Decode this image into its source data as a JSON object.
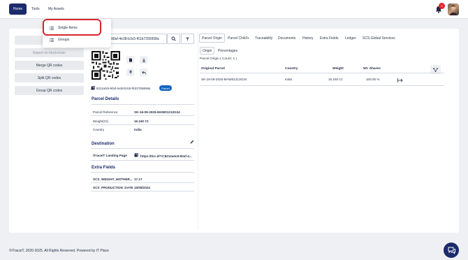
{
  "nav": {
    "home_label": "Home",
    "tools_label": "Tools",
    "my_assets_label": "My Assets",
    "notification_count": "0"
  },
  "dropdown": {
    "items": [
      {
        "label": "Single-Items"
      },
      {
        "label": "Groups"
      }
    ]
  },
  "left_panel": {
    "buttons": [
      {
        "label": "Create"
      },
      {
        "label": "Export on blockchain"
      },
      {
        "label": "Merge QR codes"
      },
      {
        "label": "Split QR codes"
      },
      {
        "label": "Group QR codes"
      }
    ]
  },
  "search": {
    "value": "90af-4e38-b3c5-f61b7255958a"
  },
  "item": {
    "uid": "8212a0c8-90af-4e38-b3c5-f61b7255958a",
    "type_badge": "Parcel"
  },
  "parcel_details": {
    "title": "Parcel Details",
    "rows": [
      {
        "label": "Parcel Reference",
        "value": "SK-16-09-2025-MAW01213G34"
      },
      {
        "label": "Weight(Ct)",
        "value": "16.160 Ct."
      },
      {
        "label": "Country",
        "value": "India"
      }
    ]
  },
  "destination": {
    "title": "Destination",
    "label": "iTraceiT Landing Page",
    "url": "https://tirc.it/?i=8212a0c8-90af-4..."
  },
  "extra_fields": {
    "title": "Extra Fields",
    "rows": [
      {
        "label": "SCS_WEIGHT_MOTHER...",
        "value": "17.17"
      },
      {
        "label": "SCS_PRODUCTION_DATE",
        "value": "15/08/2024"
      }
    ]
  },
  "tabs": [
    {
      "label": "Parcel Origin",
      "active": true
    },
    {
      "label": "Parcel Child's",
      "active": false
    },
    {
      "label": "Traceability",
      "active": false
    },
    {
      "label": "Documents",
      "active": false
    },
    {
      "label": "History",
      "active": false
    },
    {
      "label": "Extra Fields",
      "active": false
    },
    {
      "label": "Ledger",
      "active": false
    },
    {
      "label": "SCS Global Services",
      "active": false
    }
  ],
  "subtabs": [
    {
      "label": "Origin",
      "active": true
    },
    {
      "label": "Percentages",
      "active": false
    }
  ],
  "origin": {
    "count_text": "Parcel Origin ( Count: 1 )",
    "headers": [
      "Original Parcel",
      "Country",
      "Weight",
      "Wt. Shares"
    ],
    "rows": [
      {
        "parcel": "SK-16-09-2025-MAW01213G34",
        "country": "India",
        "weight": "16.160 Ct.",
        "share": "100.00 %"
      }
    ]
  },
  "footer": {
    "text": "©iTraceiT, 2020-2025. All Rights Reserved. Powered by IT Place"
  },
  "colors": {
    "brand": "#1b2b6b",
    "badge_blue": "#1565c0",
    "alert_red": "#e3242b",
    "highlight": "#d7262e"
  },
  "icons": [
    "bell-icon",
    "search-icon",
    "filter-icon",
    "list-icon",
    "copy-icon",
    "edit-icon",
    "chat-icon",
    "arrow-right-icon",
    "hierarchy-icon"
  ]
}
